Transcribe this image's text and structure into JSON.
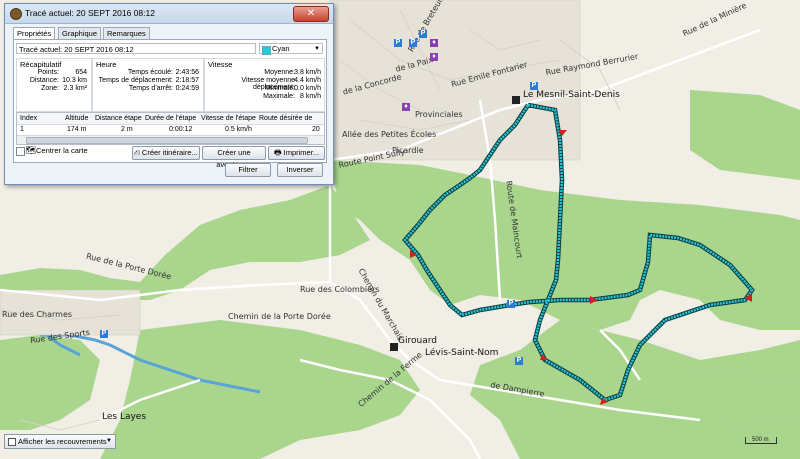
{
  "dialog": {
    "title": "Tracé actuel: 20 SEPT 2016 08:12",
    "tabs": [
      "Propriétés",
      "Graphique",
      "Remarques"
    ],
    "track_name": "Tracé actuel: 20 SEPT 2016 08:12",
    "color": {
      "name": "Cyan",
      "hex": "#28c9d6"
    },
    "recap": {
      "title": "Récapitulatif",
      "rows": [
        {
          "label": "Points:",
          "value": "654"
        },
        {
          "label": "Distance:",
          "value": "10.3 km"
        },
        {
          "label": "Zone:",
          "value": "2.3 km²"
        }
      ]
    },
    "heure": {
      "title": "Heure",
      "rows": [
        {
          "label": "Temps écoulé:",
          "value": "2:43:56"
        },
        {
          "label": "Temps de déplacement:",
          "value": "2:18:57"
        },
        {
          "label": "Temps d'arrêt:",
          "value": "0:24:59"
        }
      ]
    },
    "vitesse": {
      "title": "Vitesse",
      "rows": [
        {
          "label": "Moyenne:",
          "value": "3.8 km/h"
        },
        {
          "label": "Vitesse moyenne déplacement:",
          "value": "4.4 km/h"
        },
        {
          "label": "Minimale:",
          "value": "0.0 km/h"
        },
        {
          "label": "Maximale:",
          "value": "8 km/h"
        }
      ]
    },
    "table": {
      "headers": [
        "Index",
        "Altitude",
        "Distance étape",
        "Durée de l'étape",
        "Vitesse de l'étape",
        "Route désirée de"
      ],
      "row": [
        "1",
        "174 m",
        "2 m",
        "0:00:12",
        "0.5 km/h",
        "20"
      ]
    },
    "center_map_label": "Centrer la carte",
    "buttons": {
      "create_route": "Créer itinéraire...",
      "create_adventure": "Créer une aventure...",
      "print": "Imprimer...",
      "filter": "Filtrer",
      "invert": "Inverser"
    }
  },
  "overlay_dropdown": {
    "label": "Afficher les recouvrements"
  },
  "scale": {
    "label": "500 m"
  },
  "map_labels": {
    "mesnil": "Le Mesnil-Saint-Denis",
    "levis": "Lévis-Saint-Nom",
    "girouard": "Girouard",
    "layes": "Les Layes",
    "rue_colombiers": "Rue des Colombiers",
    "chemin_porte_doree": "Chemin de la Porte Dorée",
    "chemin_marchais": "Chemin du Marchais",
    "rue_porte_doree": "Rue de la Porte Dorée",
    "rue_sports": "Rue des Sports",
    "rue_charmes": "Rue des Charmes",
    "picardie": "Picardie",
    "allee_petites_ecoles": "Allée des Petites Écoles",
    "route_maincourt": "Route de Maincourt",
    "rue_dampierre": "de Dampierre",
    "chemin_ferme": "Chemin de la Ferme",
    "route_point_sully": "Route Point Sully",
    "rue_breteuil": "Rue de Breteuil",
    "rue_fontarier": "Rue Emile Fontarier",
    "rue_concorde": "de la Concorde",
    "rue_paix": "de la Paix",
    "provinciales": "Provinciales",
    "rue_miniere": "Rue de la Minière",
    "rue_bonne": "Rue Raymond Berrurier"
  },
  "colors": {
    "forest": "#a9d58d",
    "track": "#28c9d6",
    "track_outline": "#0c3f44",
    "water": "#5aa3d8",
    "road": "#ffffff"
  }
}
